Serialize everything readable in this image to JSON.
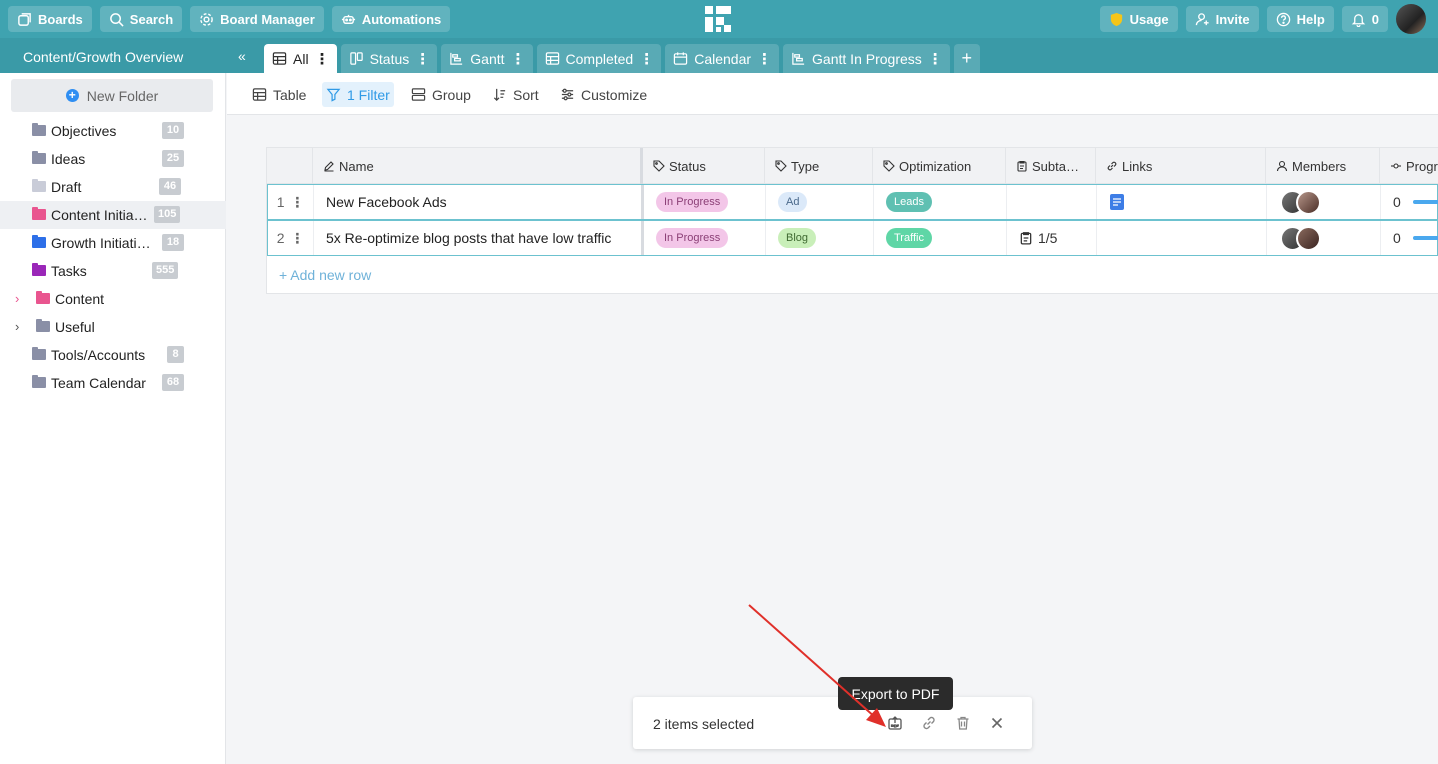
{
  "topbar": {
    "boards": "Boards",
    "search": "Search",
    "board_manager": "Board Manager",
    "automations": "Automations",
    "usage": "Usage",
    "invite": "Invite",
    "help": "Help",
    "notifications_count": "0"
  },
  "board": {
    "title": "Content/Growth Overview",
    "tabs": [
      {
        "label": "All"
      },
      {
        "label": "Status"
      },
      {
        "label": "Gantt"
      },
      {
        "label": "Completed"
      },
      {
        "label": "Calendar"
      },
      {
        "label": "Gantt In Progress"
      }
    ]
  },
  "sidebar": {
    "new_folder": "New Folder",
    "folders": [
      {
        "label": "Objectives",
        "count": "10",
        "color": "#8a8fa6"
      },
      {
        "label": "Ideas",
        "count": "25",
        "color": "#8a8fa6"
      },
      {
        "label": "Draft",
        "count": "46",
        "color": "#c9ccd8"
      },
      {
        "label": "Content Initia…",
        "count": "105",
        "color": "#e9558f"
      },
      {
        "label": "Growth Initiati…",
        "count": "18",
        "color": "#2d6fe8"
      },
      {
        "label": "Tasks",
        "count": "555",
        "color": "#9a27b8"
      },
      {
        "label": "Content",
        "color": "#e9558f"
      },
      {
        "label": "Useful",
        "color": "#8a8fa6"
      },
      {
        "label": "Tools/Accounts",
        "count": "8",
        "color": "#8a8fa6"
      },
      {
        "label": "Team Calendar",
        "count": "68",
        "color": "#8a8fa6"
      }
    ]
  },
  "toolbar": {
    "table": "Table",
    "filter": "1 Filter",
    "group": "Group",
    "sort": "Sort",
    "customize": "Customize"
  },
  "table": {
    "columns": {
      "name": "Name",
      "status": "Status",
      "type": "Type",
      "optimization": "Optimization",
      "subtasks": "Subta…",
      "links": "Links",
      "members": "Members",
      "progress": "Progr"
    },
    "rows": [
      {
        "num": "1",
        "name": "New Facebook Ads",
        "status": "In Progress",
        "type": "Ad",
        "optimization": "Leads",
        "subtasks": "",
        "progress": "0"
      },
      {
        "num": "2",
        "name": "5x Re-optimize blog posts that have low traffic",
        "status": "In Progress",
        "type": "Blog",
        "optimization": "Traffic",
        "subtasks": "1/5",
        "progress": "0"
      }
    ],
    "add_row": "+ Add new row"
  },
  "selection": {
    "count_text": "2 items selected",
    "tooltip": "Export to PDF"
  },
  "colors": {
    "topbar": "#3fa3b0",
    "status_pill": "#f3c6e8",
    "type_ad": "#dbe9f9",
    "type_blog": "#c9efb9",
    "optimization_leads": "#5fc0b2",
    "optimization_traffic": "#5fd6a6"
  }
}
